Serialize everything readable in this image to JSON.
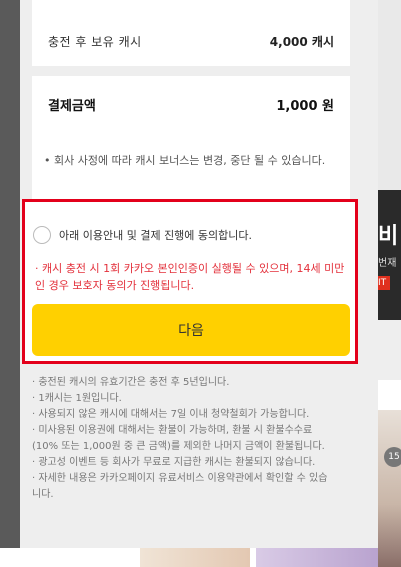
{
  "summary": {
    "held_cash_label": "충전 후 보유 캐시",
    "held_cash_value": "4,000 캐시"
  },
  "payment": {
    "amount_label": "결제금액",
    "amount_value": "1,000 원",
    "notice": "• 회사 사정에 따라 캐시 보너스는 변경, 중단 될 수 있습니다."
  },
  "agreement": {
    "checkbox_label": "아래 이용안내 및 결제 진행에 동의합니다.",
    "warning": "· 캐시 충전 시 1회 카카오 본인인증이 실행될 수 있으며, 14세 미만인 경우 보호자 동의가 진행됩니다.",
    "next_button": "다음",
    "highlight_color": "#e3001b"
  },
  "info_lines": [
    "· 충전된 캐시의 유효기간은 충전 후 5년입니다.",
    "· 1캐시는 1원입니다.",
    "· 사용되지 않은 캐시에 대해서는 7일 이내 청약철회가 가능합니다.",
    "· 미사용된 이용권에 대해서는 환불이 가능하며, 환불 시 환불수수료",
    "(10% 또는 1,000원 중 큰 금액)를 제외한 나머지 금액이 환불됩니다.",
    "· 광고성 이벤트 등 회사가 무료로 지급한 캐시는 환불되지 않습니다.",
    "· 자세한 내용은 카카오페이지 유료서비스 이용약관에서 확인할 수 있습",
    "니다."
  ],
  "background": {
    "title_fragment": "비",
    "sub_fragment": "번재",
    "badge": "IT",
    "count_badge": "15"
  },
  "colors": {
    "button": "#ffd000",
    "warning_text": "#e3303b"
  }
}
